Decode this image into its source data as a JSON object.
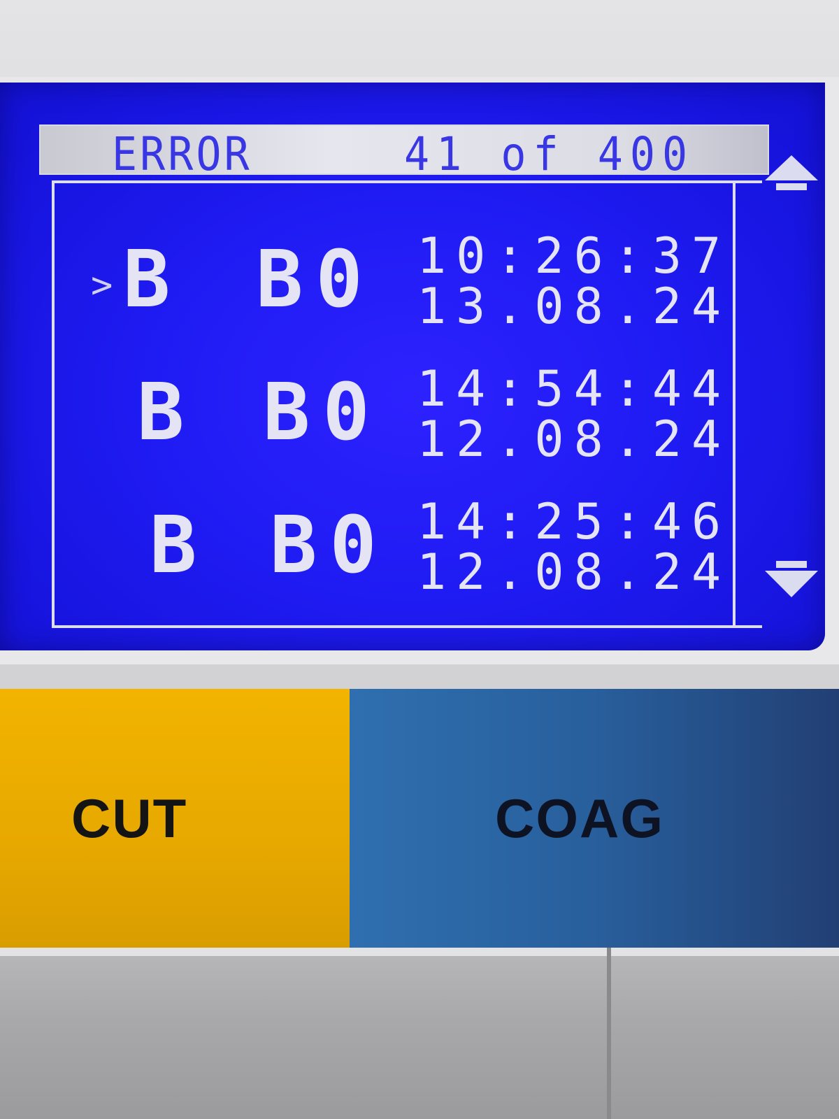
{
  "display": {
    "header": {
      "title": "ERROR",
      "counter": "41 of 400"
    },
    "cursor": ">",
    "errors": [
      {
        "category": "B",
        "code": "B0",
        "time": "10:26:37",
        "date": "13.08.24",
        "selected": true
      },
      {
        "category": "B",
        "code": "B0",
        "time": "14:54:44",
        "date": "12.08.24",
        "selected": false
      },
      {
        "category": "B",
        "code": "B0",
        "time": "14:25:46",
        "date": "12.08.24",
        "selected": false
      }
    ],
    "scroll": {
      "up_icon": "arrow-up-icon",
      "down_icon": "arrow-down-icon"
    }
  },
  "panels": {
    "cut": {
      "label": "CUT",
      "color": "#f2b400"
    },
    "coag": {
      "label": "COAG",
      "color": "#2f6fb0"
    }
  },
  "colors": {
    "lcd_background": "#1f1bf3",
    "lcd_text": "#e4e4f4",
    "header_text": "#3936e4"
  }
}
